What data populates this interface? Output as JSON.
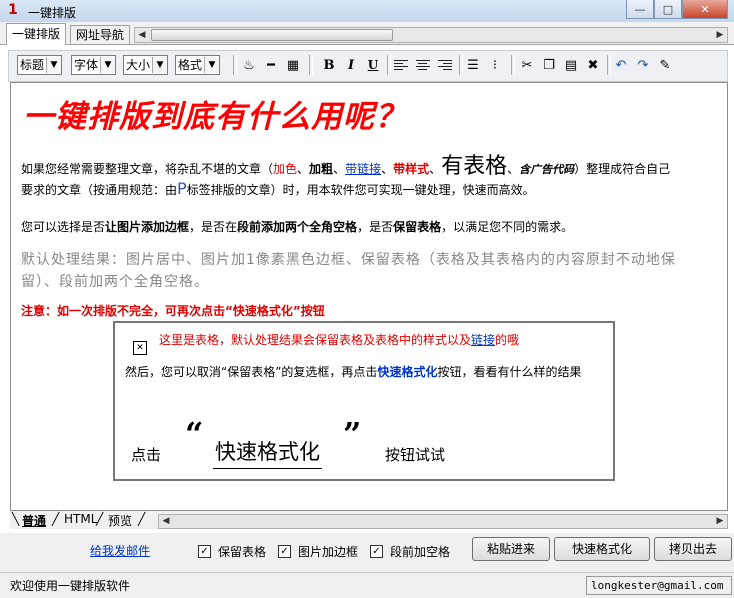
{
  "window": {
    "icon_text": "1",
    "title": "一键排版",
    "min": "—",
    "max": "□",
    "close": "✕"
  },
  "tabs": [
    {
      "label": "一键排版"
    },
    {
      "label": "网址导航"
    }
  ],
  "toolbar": {
    "selects": [
      {
        "value": "标题"
      },
      {
        "value": "字体"
      },
      {
        "value": "大小"
      },
      {
        "value": "格式"
      }
    ],
    "bold": "B",
    "italic": "I",
    "underline": "U"
  },
  "content": {
    "headline": "一键排版到底有什么用呢？",
    "p1": {
      "a": "如果您经常需要整理文章，将杂乱不堪的文章（",
      "red": "加色",
      "s1": "、",
      "bold": "加粗",
      "s2": "、",
      "link": "带链接",
      "s3": "、",
      "style": "带样式",
      "s4": "、",
      "table": "有表格",
      "s5": "、",
      "ad": "含广告代码",
      "b": "）整理成符合自己",
      "c": "要求的文章（按通用规范：由",
      "p": "P",
      "d": "标签排版的文章）时，用本软件您可实现一键处理，快速而高效。"
    },
    "p2": {
      "a": "您可以选择是否",
      "b1": "让图片添加边框",
      "m1": "，是否在",
      "b2": "段前添加两个全角空格",
      "m2": "，是否",
      "b3": "保留表格",
      "e": "，以满足您不同的需求。"
    },
    "default_result": "默认处理结果：图片居中、图片加1像素黑色边框、保留表格（表格及其表格内的内容原封不动地保留）、段前加两个全角空格。",
    "warning": "注意：如一次排版不完全，可再次点击“快速格式化”按钮",
    "box": {
      "line1": "这里是表格，默认处理结果会保留表格及表格中的样式以及",
      "line1_link": "链接",
      "line1_end": "的哦",
      "line2_a": "然后，您可以取消“保留表格”的复选框，再点击",
      "line2_bold": "快速格式化",
      "line2_b": "按钮，看看有什么样的结果",
      "click": "点击",
      "quote_l": "“",
      "format": "快速格式化",
      "quote_r": "”",
      "try": "按钮试试"
    }
  },
  "mode_tabs": [
    {
      "label": "普通"
    },
    {
      "label": "HTML"
    },
    {
      "label": "预览"
    }
  ],
  "options": {
    "email_link": "给我发邮件",
    "keep_table": {
      "label": "保留表格",
      "checked": true
    },
    "img_border": {
      "label": "图片加边框",
      "checked": true
    },
    "indent": {
      "label": "段前加空格",
      "checked": true
    },
    "paste": "粘贴进来",
    "format": "快速格式化",
    "copy_out": "拷贝出去",
    "check_mark": "✓"
  },
  "status": {
    "left": "欢迎使用一键排版软件",
    "right": "longkester@gmail.com"
  }
}
